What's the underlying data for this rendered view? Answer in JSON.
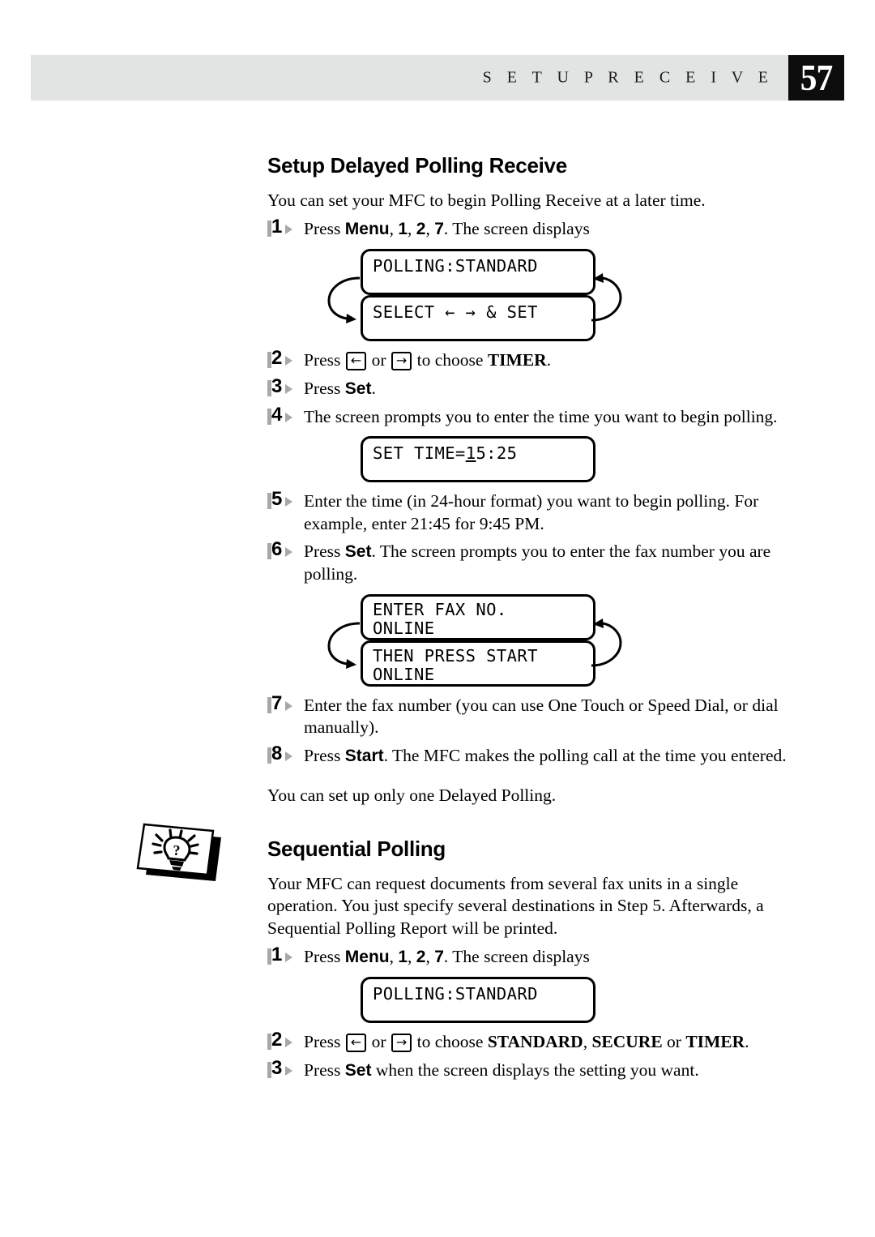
{
  "header": {
    "title": "S E T U P   R E C E I V E",
    "page_number": "57",
    "band_color": "#e1e4e3",
    "page_box_color": "#0d0d0d"
  },
  "sections": [
    {
      "heading": "Setup Delayed Polling Receive",
      "intro": "You can set your MFC to begin Polling Receive at a later time.",
      "steps": {
        "s1_num": "1",
        "s1_a": "Press ",
        "s1_b": "Menu",
        "s1_c": ", ",
        "s1_d": "1",
        "s1_e": ", ",
        "s1_f": "2",
        "s1_g": ", ",
        "s1_h": "7",
        "s1_i": ". The screen displays",
        "s2_num": "2",
        "s2_a": "Press ",
        "s2_left_key": "←",
        "s2_b": " or ",
        "s2_right_key": "→",
        "s2_c": " to choose ",
        "s2_d": "TIMER",
        "s2_e": ".",
        "s3_num": "3",
        "s3_a": "Press ",
        "s3_b": "Set",
        "s3_c": ".",
        "s4_num": "4",
        "s4_a": "The screen prompts you to enter the time you want to begin polling.",
        "s5_num": "5",
        "s5_a": "Enter the time (in 24-hour format) you want to begin polling. For example, enter 21:45 for 9:45 PM.",
        "s6_num": "6",
        "s6_a": "Press ",
        "s6_b": "Set",
        "s6_c": ". The screen prompts you to enter the fax number you are polling.",
        "s7_num": "7",
        "s7_a": "Enter the fax number (you can use One Touch or Speed Dial, or dial manually).",
        "s8_num": "8",
        "s8_a": "Press ",
        "s8_b": "Start",
        "s8_c": ". The MFC makes the polling call at the time you entered."
      },
      "note": "You can set up only one Delayed Polling."
    },
    {
      "heading": "Sequential Polling",
      "intro": "Your MFC can request documents from several fax units in a single operation. You just specify several destinations in Step 5. Afterwards, a Sequential Polling Report will be printed.",
      "steps": {
        "s1_num": "1",
        "s1_a": "Press ",
        "s1_b": "Menu",
        "s1_c": ", ",
        "s1_d": "1",
        "s1_e": ", ",
        "s1_f": "2",
        "s1_g": ", ",
        "s1_h": "7",
        "s1_i": ". The screen displays",
        "s2_num": "2",
        "s2_a": "Press ",
        "s2_left_key": "←",
        "s2_b": " or ",
        "s2_right_key": "→",
        "s2_c": " to choose ",
        "s2_d": "STANDARD",
        "s2_e": ", ",
        "s2_f": "SECURE",
        "s2_g": " or ",
        "s2_h": "TIMER",
        "s2_i": ".",
        "s3_num": "3",
        "s3_a": "Press ",
        "s3_b": "Set",
        "s3_c": " when the screen displays the setting you want."
      }
    }
  ],
  "lcd_displays": {
    "polling_standard_1": {
      "line1": "POLLING:STANDARD"
    },
    "select_set": {
      "line1": "SELECT ← → & SET"
    },
    "set_time": {
      "prefix": "SET TIME=",
      "cursor_char": "1",
      "suffix": "5:25"
    },
    "enter_fax_no": {
      "line1": "ENTER FAX NO.",
      "line2": "ONLINE"
    },
    "then_press_start": {
      "line1": "THEN PRESS START",
      "line2": "ONLINE"
    },
    "polling_standard_2": {
      "line1": "POLLING:STANDARD"
    }
  },
  "icons": {
    "note_icon": "lightbulb-note-icon",
    "left_arrow_key": "left-arrow-key-icon",
    "right_arrow_key": "right-arrow-key-icon",
    "cycle_arrow": "cycle-arrow-icon"
  }
}
